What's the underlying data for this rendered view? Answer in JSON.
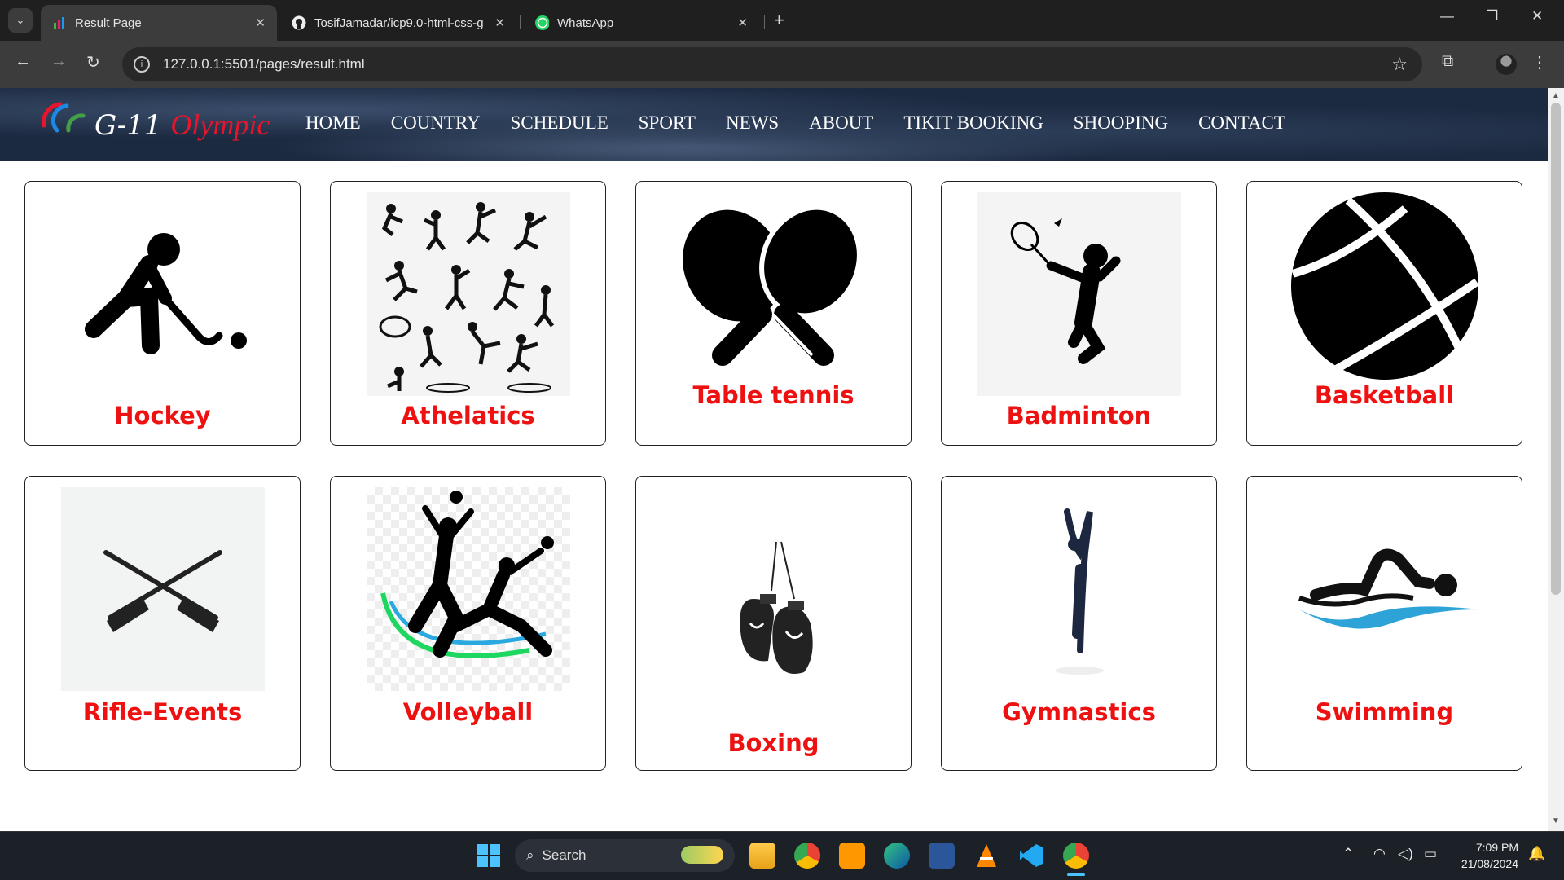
{
  "browser": {
    "tabs": [
      {
        "title": "Result Page",
        "active": true
      },
      {
        "title": "TosifJamadar/icp9.0-html-css-g",
        "active": false
      },
      {
        "title": "WhatsApp",
        "active": false
      }
    ],
    "url": "127.0.0.1:5501/pages/result.html"
  },
  "site": {
    "logo_prefix": "G-11",
    "logo_suffix": "Olympic",
    "nav": [
      "HOME",
      "COUNTRY",
      "SCHEDULE",
      "SPORT",
      "NEWS",
      "ABOUT",
      "TIKIT BOOKING",
      "SHOOPING",
      "CONTACT"
    ]
  },
  "sports": [
    {
      "name": "Hockey",
      "icon": "hockey-icon"
    },
    {
      "name": "Athelatics",
      "icon": "athletics-icon"
    },
    {
      "name": "Table tennis",
      "icon": "table-tennis-icon"
    },
    {
      "name": "Badminton",
      "icon": "badminton-icon"
    },
    {
      "name": "Basketball",
      "icon": "basketball-icon"
    },
    {
      "name": "Rifle-Events",
      "icon": "rifle-icon"
    },
    {
      "name": "Volleyball",
      "icon": "volleyball-icon"
    },
    {
      "name": "Boxing",
      "icon": "boxing-gloves-icon"
    },
    {
      "name": "Gymnastics",
      "icon": "gymnastics-icon"
    },
    {
      "name": "Swimming",
      "icon": "swimming-icon"
    }
  ],
  "colors": {
    "label": "#ee1111",
    "header_bg": "#1c2a40"
  },
  "taskbar": {
    "search_label": "Search",
    "time": "7:09 PM",
    "date": "21/08/2024"
  }
}
